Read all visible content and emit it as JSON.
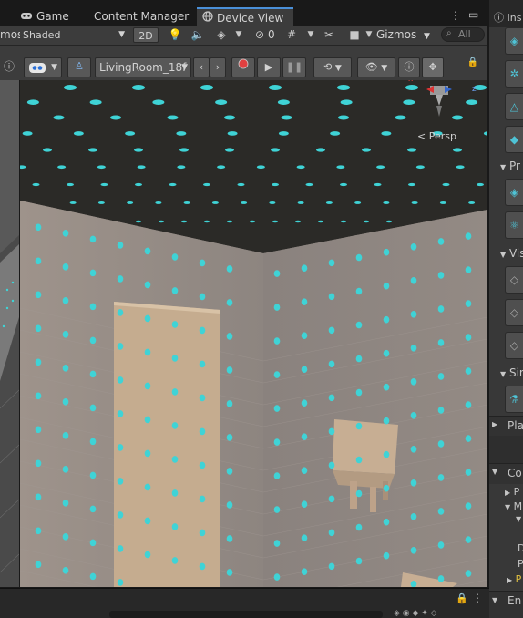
{
  "tabs": [
    {
      "label": "Game",
      "icon": "gamepad-icon",
      "active": false
    },
    {
      "label": "Content Manager",
      "icon": "",
      "active": false
    },
    {
      "label": "Device View",
      "icon": "globe-icon",
      "active": true
    }
  ],
  "scene_toolbar": {
    "left_cut_label": "mos",
    "shading_mode": "Shaded",
    "mode_2d": "2D",
    "hidden_count": "0",
    "gizmos_label": "Gizmos",
    "search_placeholder": "All"
  },
  "device_toolbar": {
    "room_select": "LivingRoom_18f"
  },
  "viewport": {
    "persp_label": "Persp",
    "gizmo_axes": [
      "x",
      "z"
    ]
  },
  "inspector": {
    "tab_label": "Ins",
    "section_headers": [
      "Pr",
      "Vis",
      "Sin",
      "Pla",
      "Co",
      "En"
    ],
    "tree_items": [
      "P",
      "M",
      "D",
      "P",
      "P"
    ]
  },
  "colors": {
    "accent_tab": "#4a90d9",
    "dot_color": "#3fd3d6",
    "record_red": "#e04040",
    "ceiling": "#2b2a27"
  }
}
